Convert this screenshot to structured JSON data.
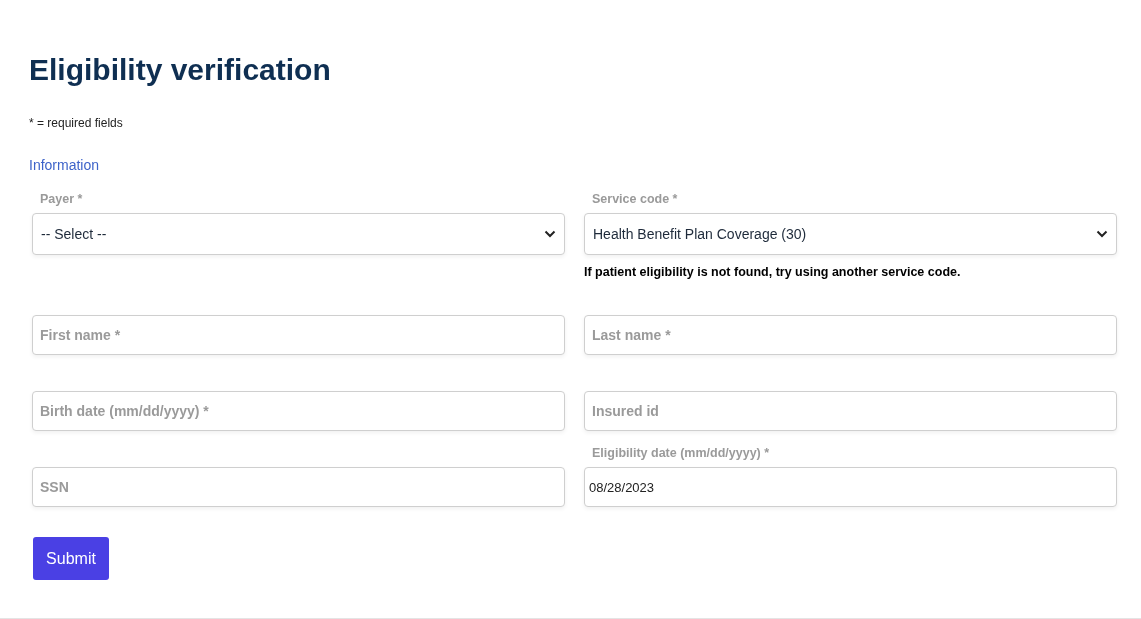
{
  "title": "Eligibility verification",
  "required_note": "* = required fields",
  "section": "Information",
  "rows": [
    {
      "fields": [
        {
          "kind": "select",
          "label": "Payer *",
          "value": "-- Select --"
        },
        {
          "kind": "select",
          "label": "Service code *",
          "value": "Health Benefit Plan Coverage (30)",
          "hint": "If patient eligibility is not found, try using another service code."
        }
      ]
    },
    {
      "fields": [
        {
          "kind": "input",
          "placeholder": "First name *"
        },
        {
          "kind": "input",
          "placeholder": "Last name *"
        }
      ]
    },
    {
      "fields": [
        {
          "kind": "input",
          "placeholder": "Birth date (mm/dd/yyyy) *"
        },
        {
          "kind": "input",
          "placeholder": "Insured id"
        }
      ]
    },
    {
      "fields": [
        {
          "kind": "input",
          "placeholder": "SSN"
        },
        {
          "kind": "input",
          "label": "Eligibility date (mm/dd/yyyy) *",
          "value": "08/28/2023"
        }
      ]
    }
  ],
  "submit": "Submit"
}
